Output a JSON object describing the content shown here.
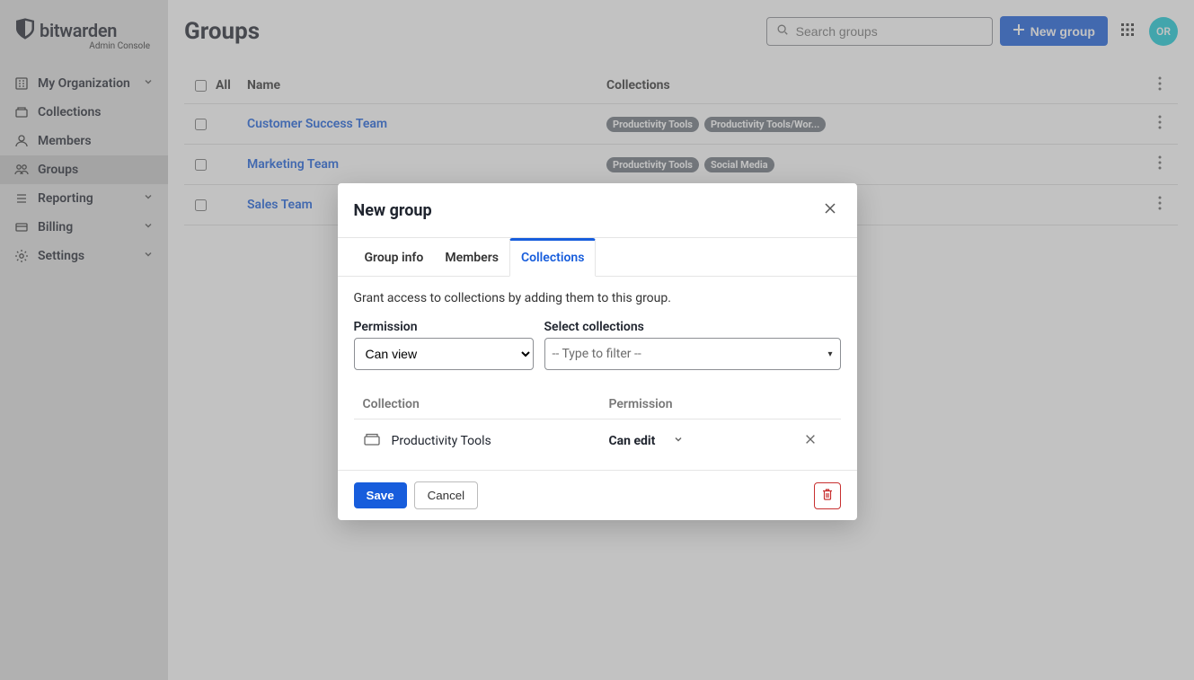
{
  "brand": {
    "name": "bitwarden",
    "sub": "Admin Console"
  },
  "sidebar": {
    "items": [
      {
        "label": "My Organization",
        "chevron": true
      },
      {
        "label": "Collections",
        "chevron": false
      },
      {
        "label": "Members",
        "chevron": false
      },
      {
        "label": "Groups",
        "chevron": false
      },
      {
        "label": "Reporting",
        "chevron": true
      },
      {
        "label": "Billing",
        "chevron": true
      },
      {
        "label": "Settings",
        "chevron": true
      }
    ]
  },
  "page": {
    "title": "Groups",
    "search_placeholder": "Search groups",
    "new_button": "New group",
    "avatar_initials": "OR"
  },
  "table": {
    "all_label": "All",
    "col_name": "Name",
    "col_collections": "Collections",
    "rows": [
      {
        "name": "Customer Success Team",
        "badges": [
          "Productivity Tools",
          "Productivity Tools/Wor..."
        ]
      },
      {
        "name": "Marketing Team",
        "badges": [
          "Productivity Tools",
          "Social Media"
        ]
      },
      {
        "name": "Sales Team",
        "badges": []
      }
    ]
  },
  "modal": {
    "title": "New group",
    "tabs": {
      "info": "Group info",
      "members": "Members",
      "collections": "Collections"
    },
    "desc": "Grant access to collections by adding them to this group.",
    "perm_label": "Permission",
    "perm_value": "Can view",
    "select_label": "Select collections",
    "filter_placeholder": "-- Type to filter --",
    "table": {
      "col_collection": "Collection",
      "col_permission": "Permission",
      "rows": [
        {
          "name": "Productivity Tools",
          "permission": "Can edit"
        }
      ]
    },
    "save": "Save",
    "cancel": "Cancel"
  }
}
